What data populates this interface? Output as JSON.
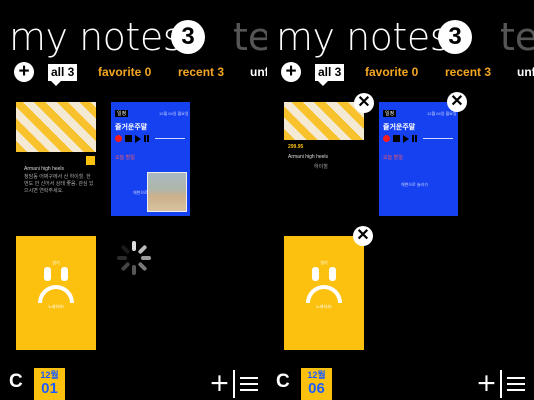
{
  "screens": [
    {
      "header": {
        "title": "my notes",
        "count": "3",
        "next_title": "te"
      },
      "filters": {
        "add": "+",
        "all": "all 3",
        "favorite": "favorite 0",
        "recent": "recent 3",
        "next": "unf"
      },
      "notes": {
        "note1": {
          "title": "Armani high heels",
          "body": "청담동 어쩌구에서 산 하이힐. 한번도 안 신어서 상태 좋음. 관심 있으시면 연락주세요."
        },
        "note2": {
          "tag": "일정",
          "header": "12월 04일 월요일",
          "title": "즐거운주말",
          "sub": "오늘 할일",
          "footer": "해변으로 놀러가"
        },
        "note3": {
          "tag": "일기",
          "footer": "노래하자!"
        }
      },
      "bottom": {
        "sync": "C",
        "month": "12월",
        "day": "01",
        "add": "+"
      }
    },
    {
      "header": {
        "title": "my notes",
        "count": "3",
        "next_title": "te"
      },
      "filters": {
        "add": "+",
        "all": "all 3",
        "favorite": "favorite 0",
        "recent": "recent 3",
        "next": "unf"
      },
      "notes": {
        "note1": {
          "price": "299.95",
          "title": "Armani high heels",
          "sub": "하이힐"
        },
        "note2": {
          "tag": "일정",
          "header": "12월 04일 월요일",
          "title": "즐거운주말",
          "sub": "오늘 할일",
          "footer": "해변으로 놀러가"
        },
        "note3": {
          "tag": "일기",
          "footer": "노래하자!"
        }
      },
      "bottom": {
        "sync": "C",
        "month": "12월",
        "day": "06",
        "add": "+"
      }
    }
  ],
  "icons": {
    "close": "close-icon",
    "menu": "hamburger-icon",
    "spinner": "loading-spinner-icon"
  },
  "colors": {
    "accent": "#f5a623",
    "yellow": "#fcc10f",
    "blue": "#1641f0",
    "date_text": "#1d5cff"
  }
}
